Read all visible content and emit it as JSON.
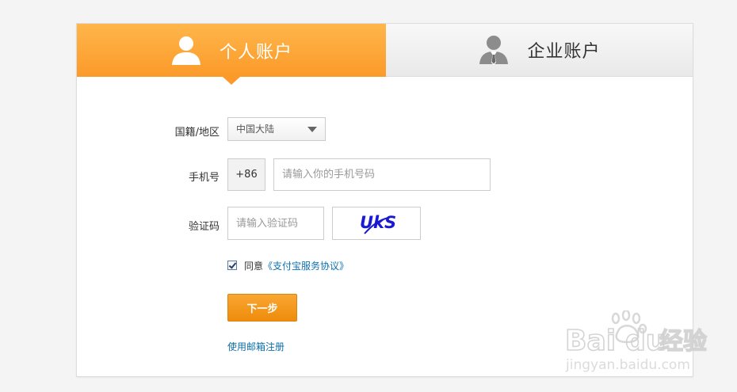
{
  "tabs": {
    "personal": {
      "label": "个人账户",
      "icon": "user-icon",
      "active": true
    },
    "business": {
      "label": "企业账户",
      "icon": "business-user-icon",
      "active": false
    }
  },
  "form": {
    "region": {
      "label": "国籍/地区",
      "value": "中国大陆"
    },
    "phone": {
      "label": "手机号",
      "prefix": "+86",
      "placeholder": "请输入你的手机号码"
    },
    "captcha": {
      "label": "验证码",
      "placeholder": "请输入验证码",
      "image_text": "UkS"
    },
    "agree": {
      "checked": true,
      "text": "同意",
      "link": "《支付宝服务协议》"
    },
    "next_button": "下一步",
    "email_link": "使用邮箱注册"
  },
  "watermark": {
    "brand": "Bai du 经验",
    "url": "jingyan.baidu.com"
  },
  "colors": {
    "accent_orange": "#fb9a2a",
    "button_orange": "#ee8c0c",
    "link_blue": "#0d71b0",
    "captcha_blue": "#1a1ad0"
  }
}
